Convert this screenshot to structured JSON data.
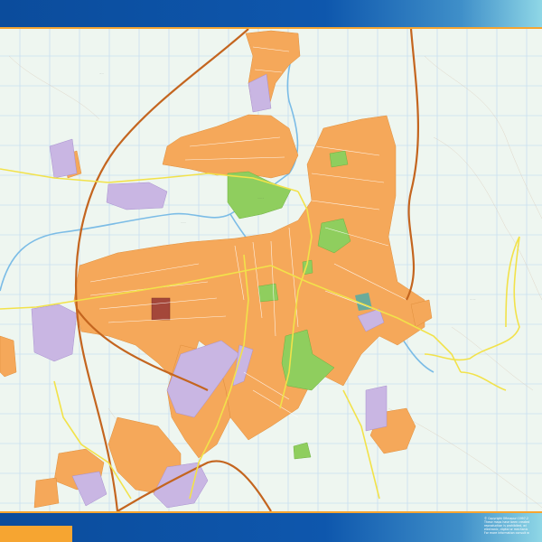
{
  "colors": {
    "header": "#0e57ad",
    "accent": "#f6a531",
    "urban": "#f5a85a",
    "industrial": "#c9b6e3",
    "park": "#8fce5e",
    "river": "#7bbce6",
    "highway": "#c4651f",
    "road_major": "#f2e24a",
    "grid": "#c8dff0",
    "background": "#eef6f0"
  },
  "copyright": {
    "lines": [
      "© Copyright Ofimapuri 1997-2",
      "These maps have been created",
      "reproduction is prohibited, wi",
      "electronic, digital or mechanic",
      "For more information consult w"
    ]
  }
}
